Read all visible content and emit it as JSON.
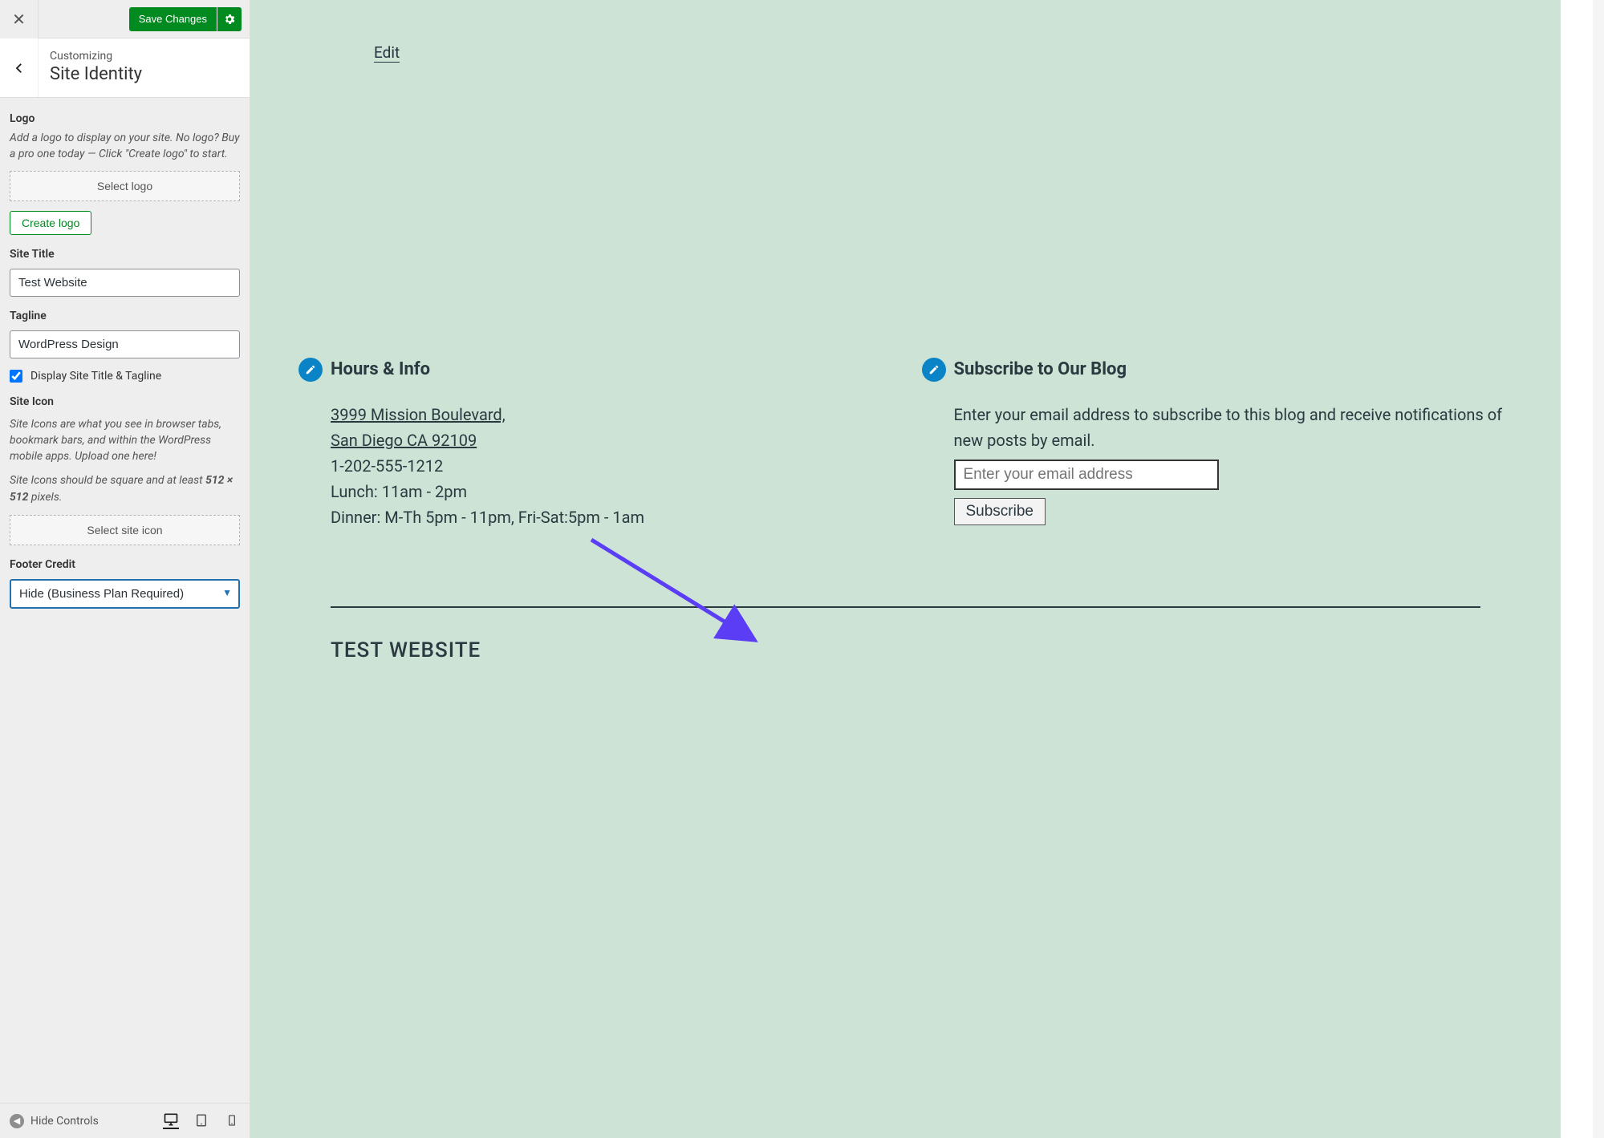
{
  "topbar": {
    "save_label": "Save Changes"
  },
  "header": {
    "breadcrumb": "Customizing",
    "title": "Site Identity"
  },
  "logo": {
    "heading": "Logo",
    "desc": "Add a logo to display on your site. No logo? Buy a pro one today — Click \"Create logo\" to start.",
    "select_label": "Select logo",
    "create_label": "Create logo"
  },
  "site_title": {
    "label": "Site Title",
    "value": "Test Website"
  },
  "tagline": {
    "label": "Tagline",
    "value": "WordPress Design"
  },
  "display_toggle": {
    "label": "Display Site Title & Tagline",
    "checked": true
  },
  "site_icon": {
    "heading": "Site Icon",
    "desc": "Site Icons are what you see in browser tabs, bookmark bars, and within the WordPress mobile apps. Upload one here!",
    "note_pre": "Site Icons should be square and at least ",
    "note_bold": "512 × 512",
    "note_post": " pixels.",
    "select_label": "Select site icon"
  },
  "footer_credit": {
    "label": "Footer Credit",
    "value": "Hide (Business Plan Required)"
  },
  "device_bar": {
    "hide_label": "Hide Controls"
  },
  "preview": {
    "edit_link": "Edit",
    "widgets": {
      "hours": {
        "title": "Hours & Info",
        "address_line1": "3999 Mission Boulevard,",
        "address_line2": "San Diego CA 92109",
        "phone": "1-202-555-1212",
        "lunch": "Lunch: 11am - 2pm",
        "dinner": "Dinner: M-Th 5pm - 11pm, Fri-Sat:5pm - 1am"
      },
      "subscribe": {
        "title": "Subscribe to Our Blog",
        "desc": "Enter your email address to subscribe to this blog and receive notifications of new posts by email.",
        "placeholder": "Enter your email address",
        "button": "Subscribe"
      }
    },
    "footer_site_title": "TEST WEBSITE"
  },
  "colors": {
    "accent_green": "#008a20",
    "preview_bg": "#cce3d6",
    "arrow": "#5b3df5",
    "badge_blue": "#0a84c7"
  }
}
